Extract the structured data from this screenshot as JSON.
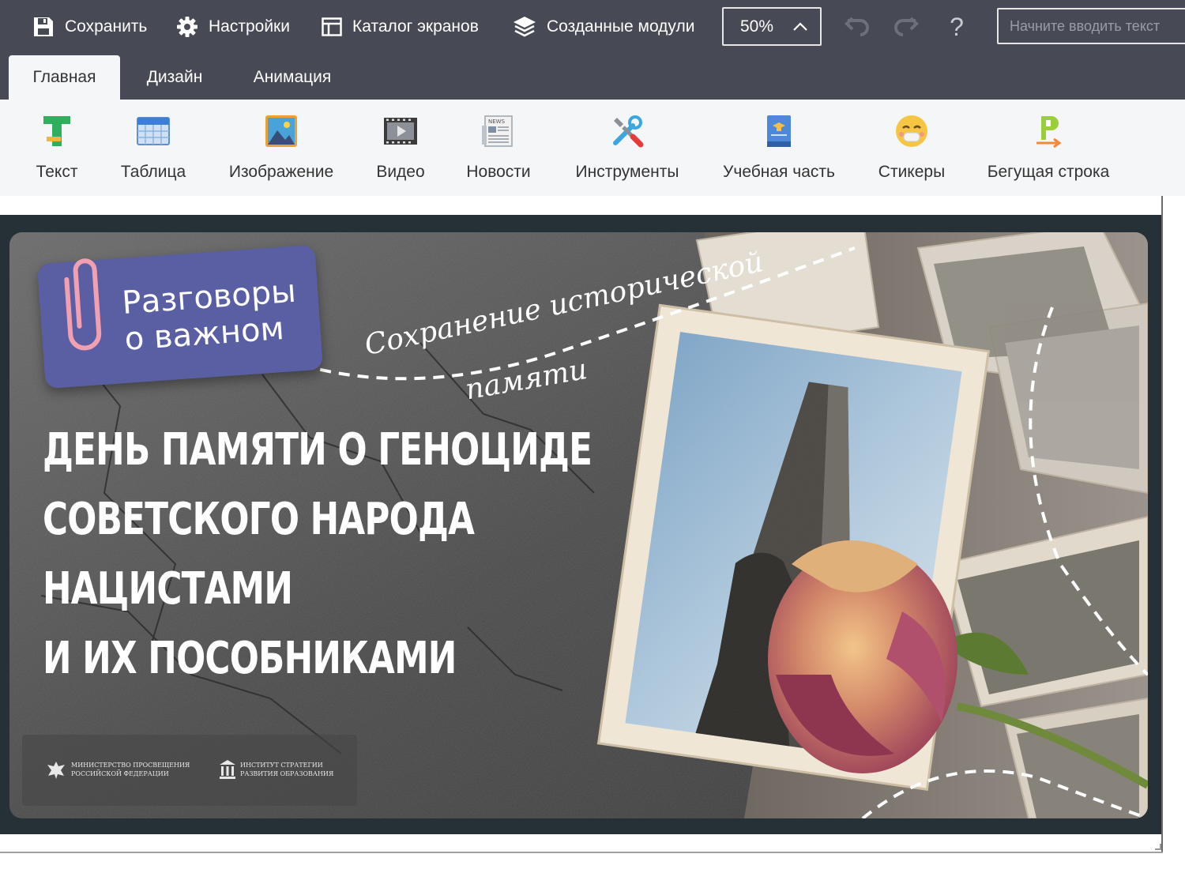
{
  "toolbar": {
    "save_label": "Сохранить",
    "settings_label": "Настройки",
    "catalog_label": "Каталог экранов",
    "modules_label": "Созданные модули",
    "zoom_value": "50%",
    "help_label": "?",
    "search_placeholder": "Начните вводить текст"
  },
  "tabs": [
    {
      "label": "Главная",
      "active": true
    },
    {
      "label": "Дизайн",
      "active": false
    },
    {
      "label": "Анимация",
      "active": false
    }
  ],
  "ribbon": {
    "items": [
      {
        "label": "Текст",
        "icon": "text-icon"
      },
      {
        "label": "Таблица",
        "icon": "table-icon"
      },
      {
        "label": "Изображение",
        "icon": "image-icon"
      },
      {
        "label": "Видео",
        "icon": "video-icon"
      },
      {
        "label": "Новости",
        "icon": "news-icon"
      },
      {
        "label": "Инструменты",
        "icon": "tools-icon"
      },
      {
        "label": "Учебная часть",
        "icon": "book-icon"
      },
      {
        "label": "Стикеры",
        "icon": "sticker-icon"
      },
      {
        "label": "Бегущая строка",
        "icon": "ticker-icon"
      }
    ]
  },
  "slide": {
    "badge_line1": "Разговоры",
    "badge_line2": "о важном",
    "script_line1": "Сохранение исторической",
    "script_line2": "памяти",
    "headline": [
      "ДЕНЬ ПАМЯТИ О ГЕНОЦИДЕ",
      "СОВЕТСКОГО НАРОДА",
      "НАЦИСТАМИ",
      "И ИХ ПОСОБНИКАМИ"
    ],
    "logo_left": [
      "МИНИСТЕРСТВО ПРОСВЕЩЕНИЯ",
      "РОССИЙСКОЙ ФЕДЕРАЦИИ"
    ],
    "logo_right": [
      "ИНСТИТУТ СТРАТЕГИИ",
      "РАЗВИТИЯ ОБРАЗОВАНИЯ"
    ]
  },
  "colors": {
    "toolbar_bg": "#474a55",
    "ribbon_bg": "#f5f6f8",
    "badge": "#5a5fa3",
    "stage_bg": "#253037"
  }
}
